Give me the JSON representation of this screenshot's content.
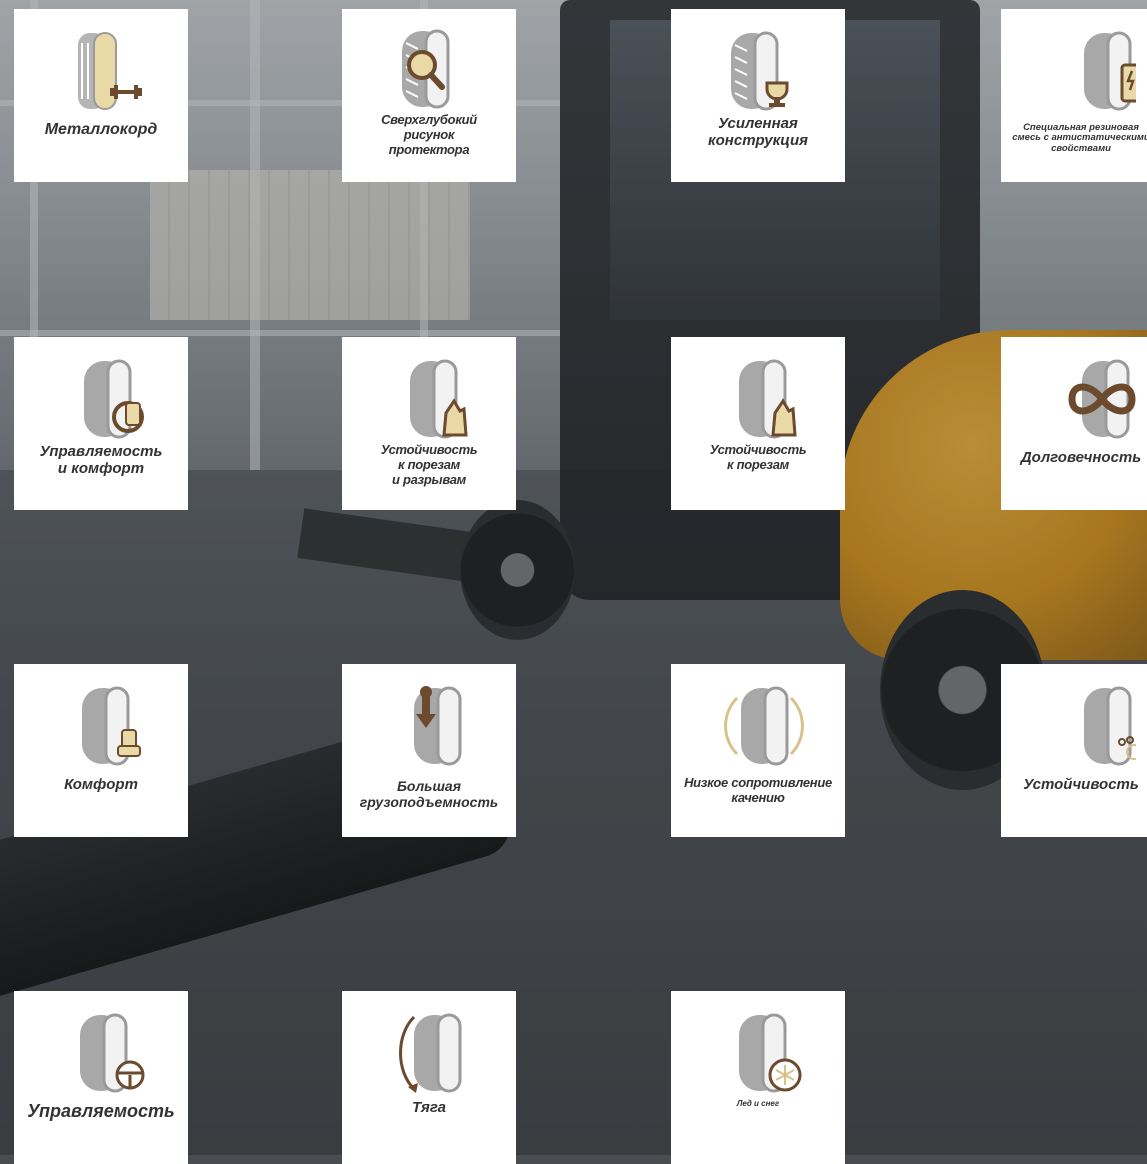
{
  "tiles": [
    {
      "label": "Металлокорд",
      "icon": "metal-cord-icon"
    },
    {
      "label": "Сверхглубокий\nрисунок\nпротектора",
      "icon": "deep-tread-magnifier-icon"
    },
    {
      "label": "Усиленная\nконструкция",
      "icon": "trophy-icon"
    },
    {
      "label": "Специальная резиновая\nсмесь с антистатическими\nсвойствами",
      "icon": "antistatic-phone-icon"
    },
    {
      "label": "Управляемость\nи комфорт",
      "icon": "steering-seat-icon"
    },
    {
      "label": "Устойчивость\nк порезам\nи разрывам",
      "icon": "rock-icon"
    },
    {
      "label": "Устойчивость\nк порезам",
      "icon": "rock-icon"
    },
    {
      "label": "Долговечность",
      "icon": "infinity-icon"
    },
    {
      "label": "Комфорт",
      "icon": "seat-icon"
    },
    {
      "label": "Большая\nгрузоподъемность",
      "icon": "weight-arrow-icon"
    },
    {
      "label": "Низкое сопротивление\nкачению",
      "icon": "rolling-arcs-icon"
    },
    {
      "label": "Устойчивость",
      "icon": "stability-circles-icon"
    },
    {
      "label": "Управляемость",
      "icon": "steering-wheel-icon"
    },
    {
      "label": "Тяга",
      "icon": "traction-arrow-icon"
    },
    {
      "label": "Лед и снег",
      "icon": "snowflake-icon"
    }
  ],
  "colors": {
    "tire": "#9a9a9a",
    "accent_brown": "#6b4a2e",
    "accent_gold": "#d8c08a",
    "label": "#333333"
  }
}
